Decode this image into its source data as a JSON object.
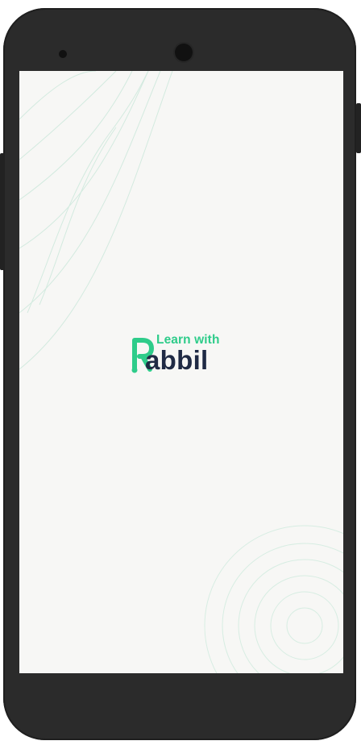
{
  "device": {
    "frame_color": "#2b2b2b",
    "screen_color": "#f7f7f5"
  },
  "splash": {
    "logo_small_text": "Learn with",
    "logo_big_text": "abbil",
    "brand_green": "#2ecc8a",
    "brand_navy": "#1f2a44",
    "logo_mark_letter": "R"
  }
}
